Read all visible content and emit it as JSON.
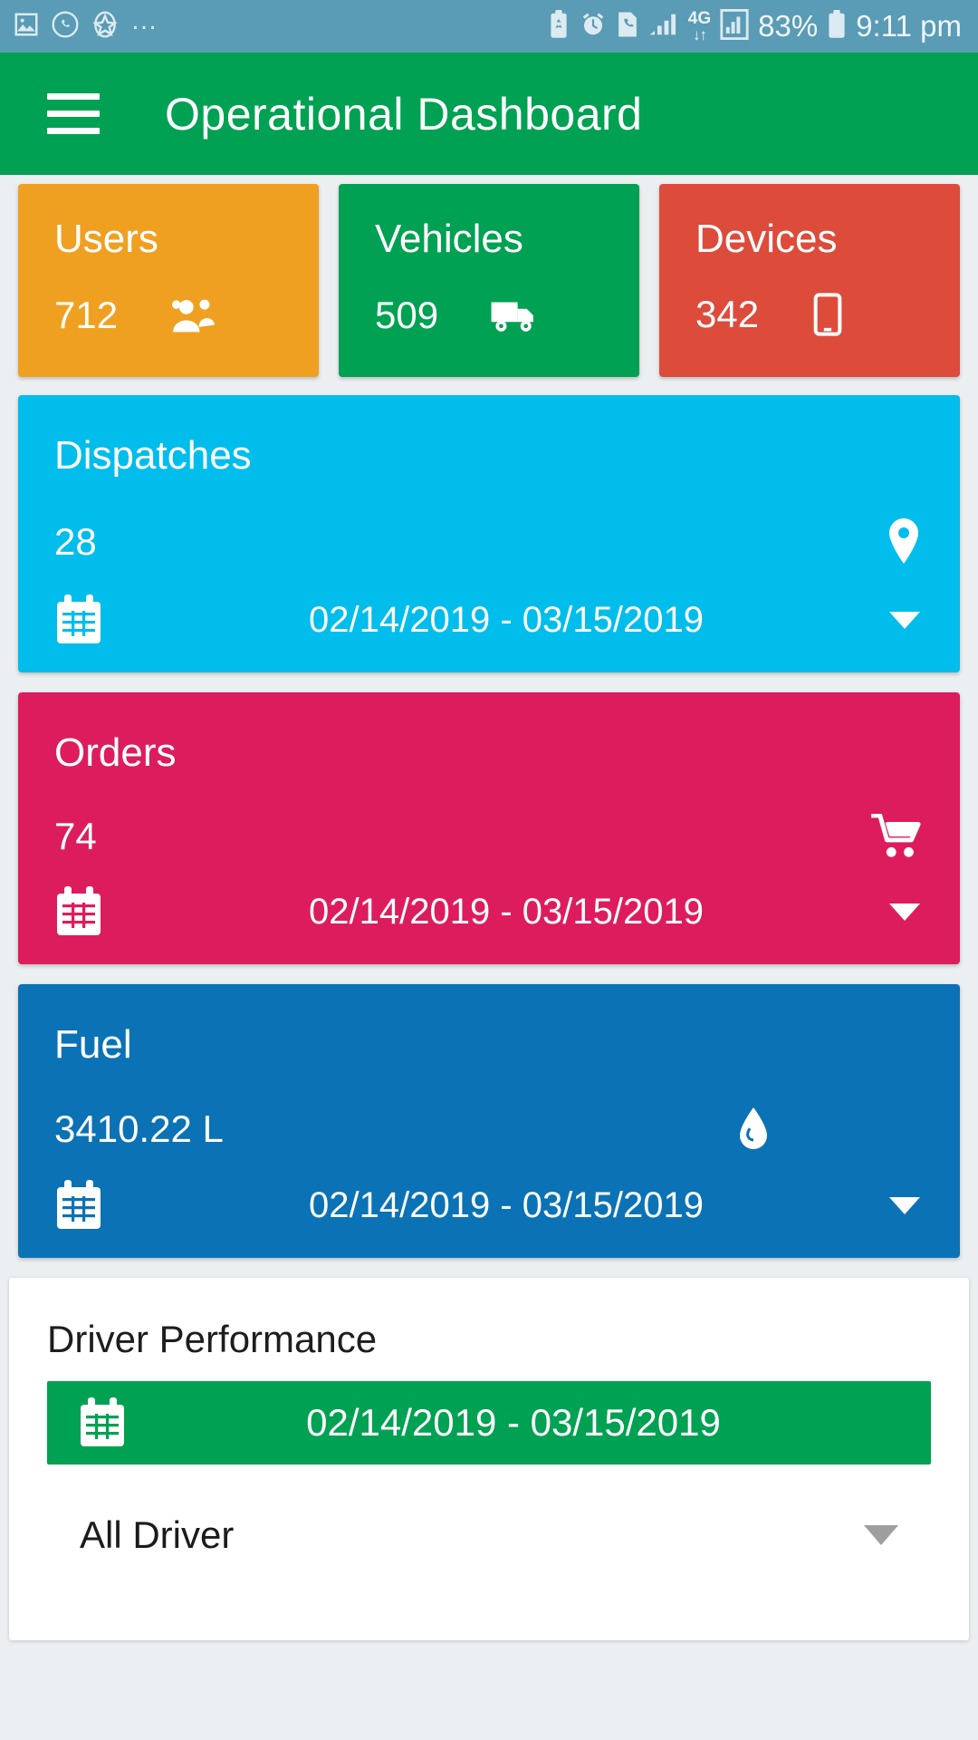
{
  "statusbar": {
    "left_icons": [
      "photo-icon",
      "whatsapp-icon",
      "compass-icon"
    ],
    "overflow": "…",
    "right_icons": [
      "battery-saver-icon",
      "alarm-clock-icon",
      "phone-sim-icon",
      "signal-bars-icon",
      "data-transfer-icon",
      "signal-strength-icon"
    ],
    "network_label": "4G",
    "data_arrows": "↓↑",
    "battery_percent": "83%",
    "time": "9:11 pm",
    "bg_color": "#5a9bb5"
  },
  "appbar": {
    "menu_icon": "hamburger-menu-icon",
    "title": "Operational Dashboard",
    "bg_color": "#00a152"
  },
  "stat_cards": [
    {
      "label": "Users",
      "value": "712",
      "icon": "people-icon",
      "color": "#f0a020"
    },
    {
      "label": "Vehicles",
      "value": "509",
      "icon": "truck-icon",
      "color": "#00a152"
    },
    {
      "label": "Devices",
      "value": "342",
      "icon": "tablet-icon",
      "color": "#dd4b3b"
    }
  ],
  "wide_cards": [
    {
      "label": "Dispatches",
      "value": "28",
      "icon": "map-pin-icon",
      "calendar_icon": "calendar-icon",
      "date_range": "02/14/2019 - 03/15/2019",
      "caret_icon": "chevron-down-icon",
      "color": "#00bdec"
    },
    {
      "label": "Orders",
      "value": "74",
      "icon": "shopping-cart-icon",
      "calendar_icon": "calendar-icon",
      "date_range": "02/14/2019 - 03/15/2019",
      "caret_icon": "chevron-down-icon",
      "color": "#dd1c5e"
    },
    {
      "label": "Fuel",
      "value": "3410.22 L",
      "icon": "fuel-drop-icon",
      "calendar_icon": "calendar-icon",
      "date_range": "02/14/2019 - 03/15/2019",
      "caret_icon": "chevron-down-icon",
      "color": "#0b72b5"
    }
  ],
  "driver_performance": {
    "title": "Driver Performance",
    "calendar_icon": "calendar-icon",
    "date_range": "02/14/2019 - 03/15/2019",
    "date_btn_color": "#00a152",
    "driver_select": "All Driver",
    "select_caret_icon": "chevron-down-icon"
  }
}
